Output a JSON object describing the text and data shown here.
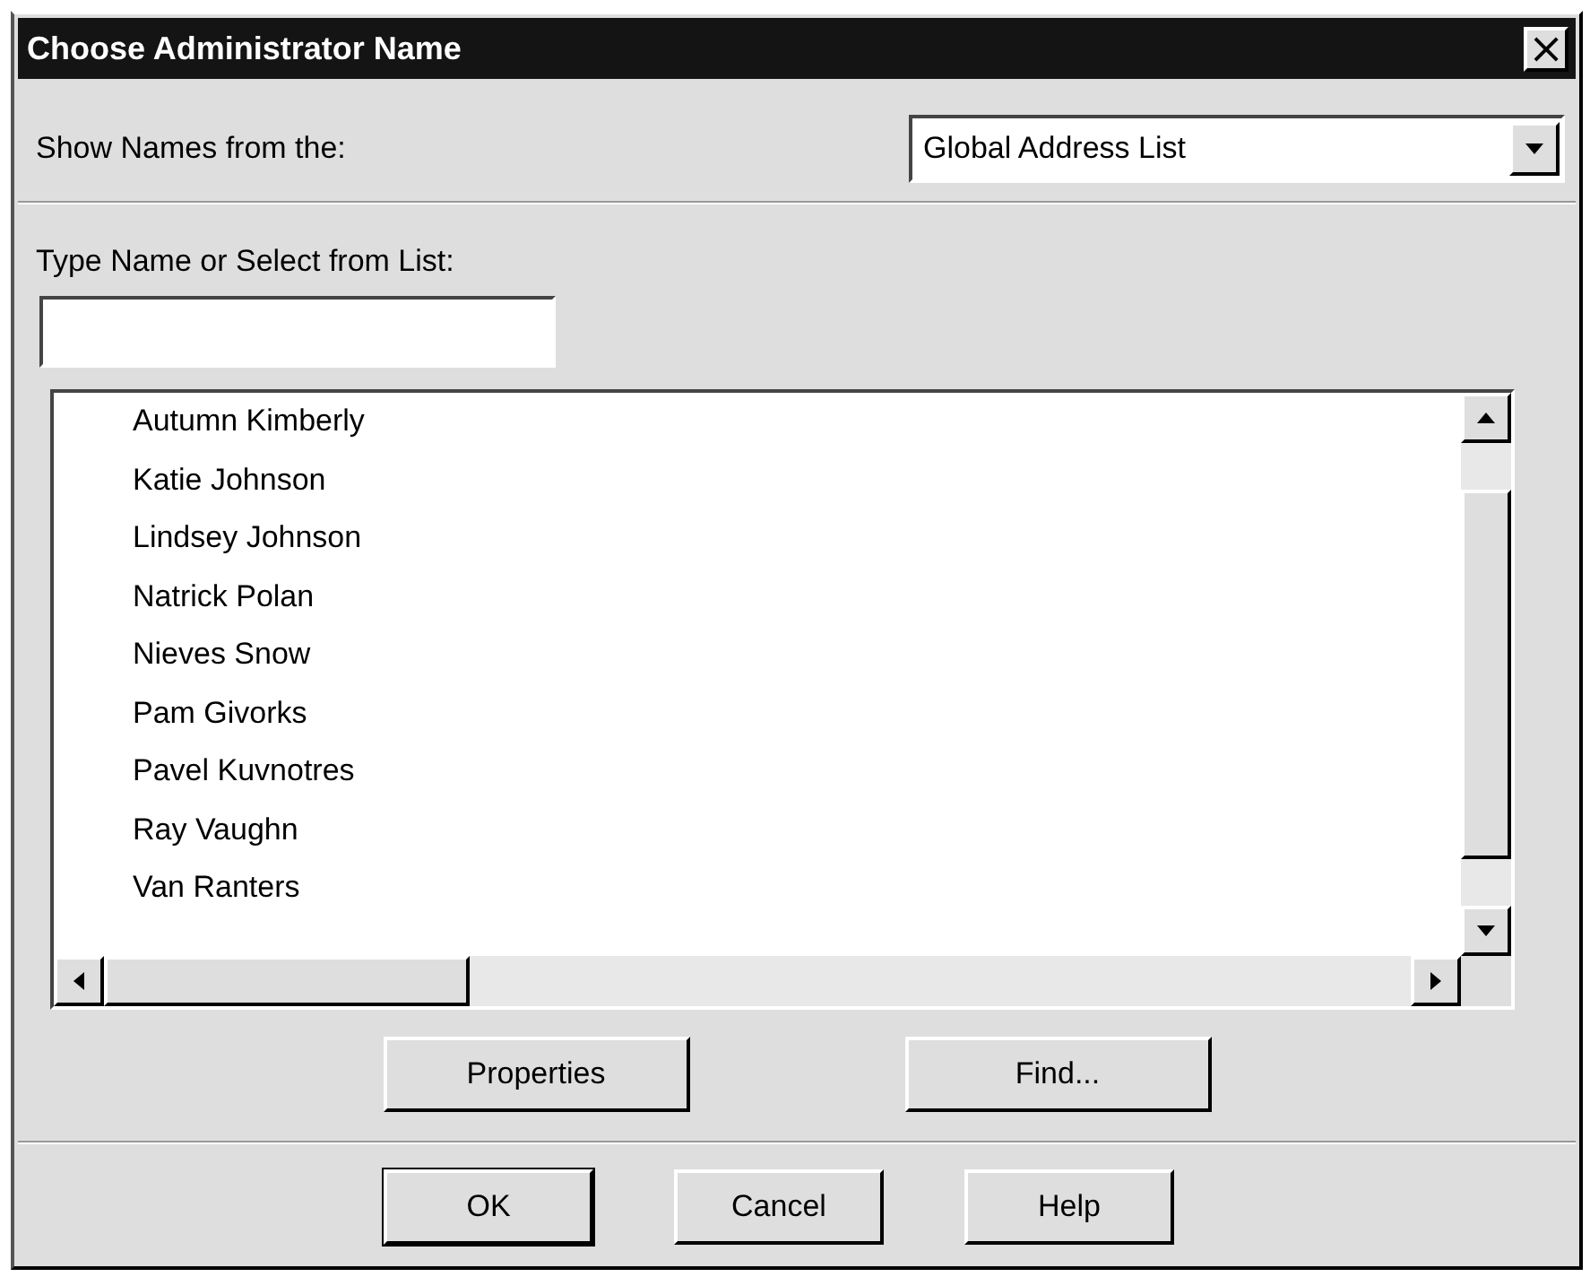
{
  "window": {
    "title": "Choose Administrator Name",
    "close": "×"
  },
  "show_names": {
    "label": "Show Names from the:",
    "value": "Global Address List"
  },
  "type_name": {
    "label": "Type Name or Select from List:"
  },
  "names": [
    {
      "label": "Autumn Kimberly"
    },
    {
      "label": "Katie Johnson"
    },
    {
      "label": "Lindsey Johnson"
    },
    {
      "label": "Natrick Polan"
    },
    {
      "label": "Nieves Snow"
    },
    {
      "label": "Pam Givorks"
    },
    {
      "label": "Pavel Kuvnotres"
    },
    {
      "label": "Ray Vaughn"
    },
    {
      "label": "Van Ranters"
    }
  ],
  "list_buttons": [
    {
      "label": "Properties",
      "default": false
    },
    {
      "label": "Find...",
      "default": false
    }
  ],
  "buttons": [
    {
      "label": "OK",
      "default": true
    },
    {
      "label": "Cancel",
      "default": false
    },
    {
      "label": "Help",
      "default": false
    }
  ]
}
